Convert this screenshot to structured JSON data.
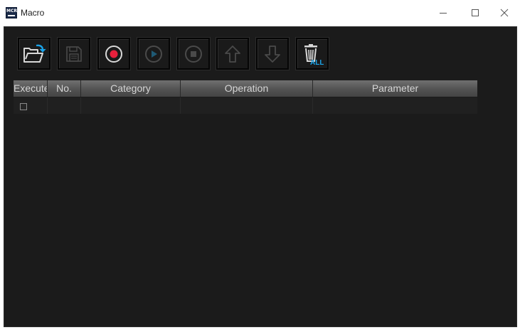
{
  "window": {
    "app_icon_text": "MCR",
    "title": "Macro",
    "controls": [
      "minimize",
      "maximize",
      "close"
    ]
  },
  "toolbar": {
    "buttons": [
      {
        "name": "open-button",
        "icon": "folder-open-icon",
        "enabled": true
      },
      {
        "name": "save-button",
        "icon": "floppy-disk-icon",
        "enabled": false
      },
      {
        "name": "record-button",
        "icon": "record-icon",
        "enabled": true
      },
      {
        "name": "play-button",
        "icon": "play-icon",
        "enabled": false
      },
      {
        "name": "stop-button",
        "icon": "stop-icon",
        "enabled": false
      },
      {
        "name": "move-up-button",
        "icon": "arrow-up-icon",
        "enabled": false
      },
      {
        "name": "move-down-button",
        "icon": "arrow-down-icon",
        "enabled": false
      },
      {
        "name": "delete-all-button",
        "icon": "trash-all-icon",
        "enabled": true,
        "badge": "ALL"
      }
    ]
  },
  "grid": {
    "columns": [
      "Execute",
      "No.",
      "Category",
      "Operation",
      "Parameter"
    ],
    "rows": [
      {
        "execute": false,
        "no": "",
        "category": "",
        "operation": "",
        "parameter": ""
      }
    ]
  },
  "colors": {
    "background": "#1b1b1b",
    "accent_blue": "#1aa3e8",
    "record_red": "#e8203c"
  }
}
